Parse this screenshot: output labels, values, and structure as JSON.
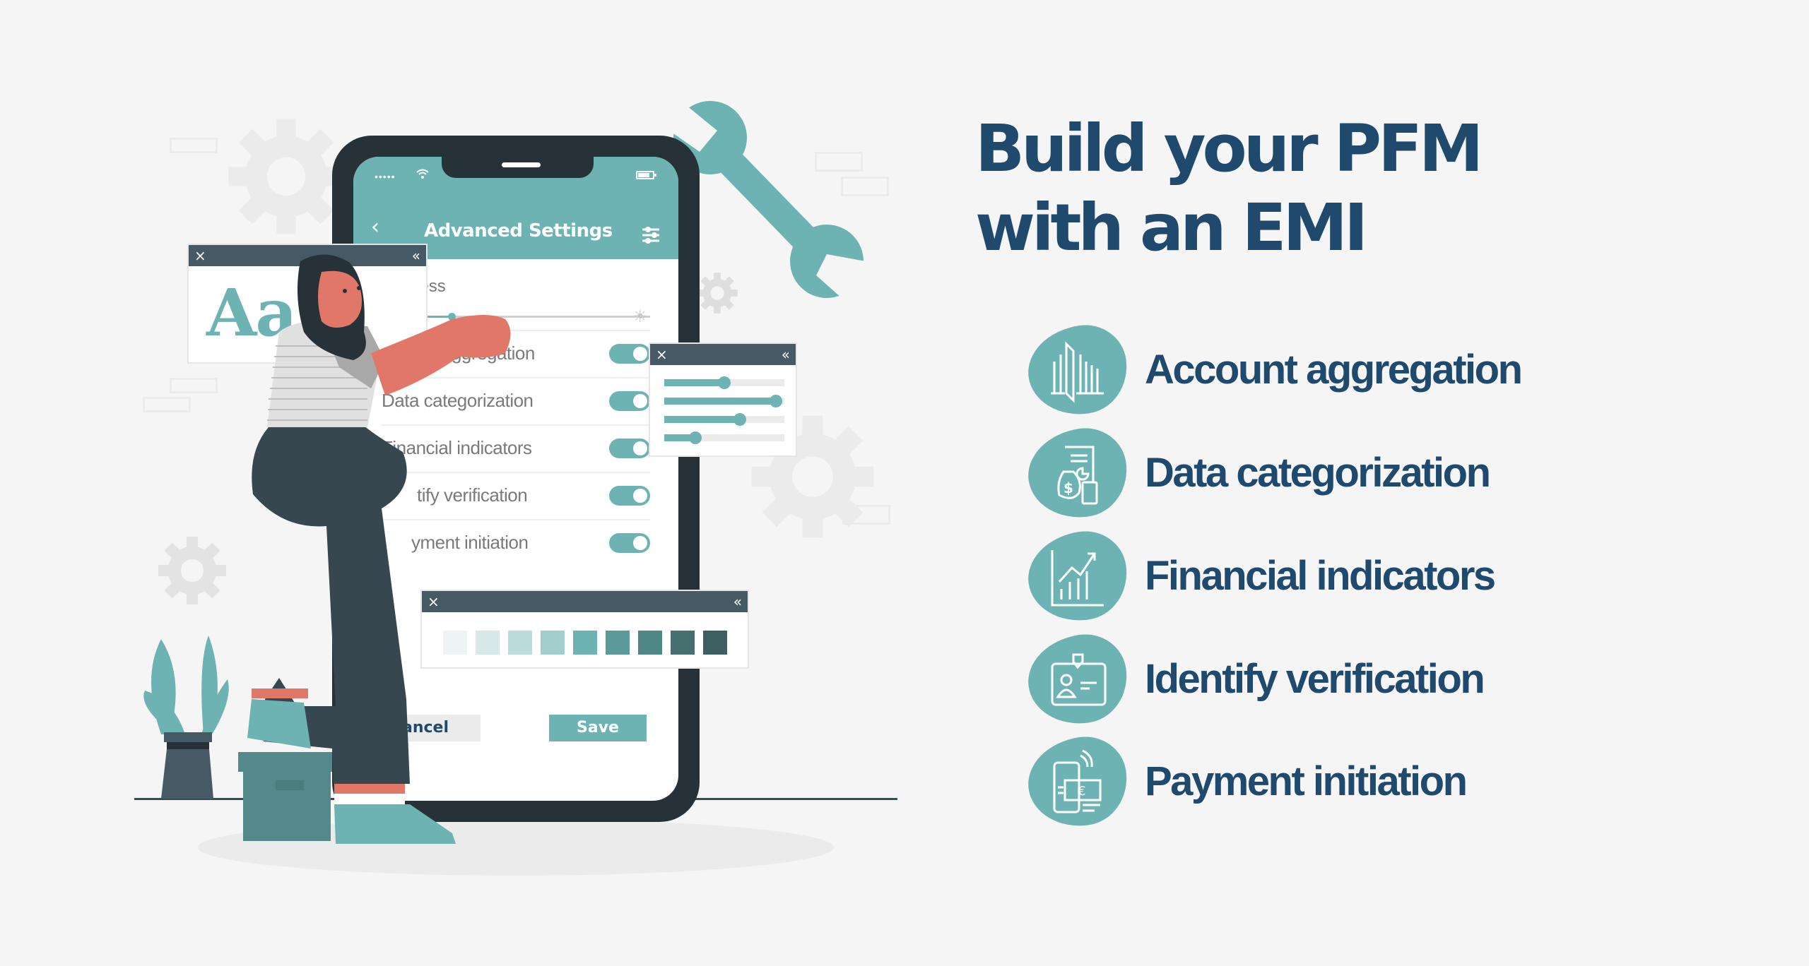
{
  "headline": {
    "line1": "Build your PFM",
    "line2": "with an EMI"
  },
  "colors": {
    "navy": "#1f4a6e",
    "teal": "#6db3b3",
    "dark": "#263238",
    "panel_bar": "#455a64",
    "background": "#f5f5f5"
  },
  "features": [
    {
      "label": "Account aggregation",
      "icon": "account-aggregation-icon"
    },
    {
      "label": "Data categorization",
      "icon": "data-categorization-icon"
    },
    {
      "label": "Financial indicators",
      "icon": "financial-indicators-icon"
    },
    {
      "label": "Identify verification",
      "icon": "identity-card-icon"
    },
    {
      "label": "Payment initiation",
      "icon": "payment-phone-icon"
    }
  ],
  "phone": {
    "status_signal": "•••••",
    "title": "Advanced Settings",
    "back_icon": "‹",
    "brightness_label": "Brightness",
    "brightness_visible_label": "htness",
    "brightness_level": 0.22,
    "settings": [
      {
        "label": "Account aggregation",
        "visible_label": "aggregation",
        "enabled": true
      },
      {
        "label": "Data categorization",
        "visible_label": "Data categorization",
        "enabled": true
      },
      {
        "label": "Financial indicators",
        "visible_label": "Financial indicators",
        "enabled": true
      },
      {
        "label": "Identify verification",
        "visible_label": "tify verification",
        "enabled": true
      },
      {
        "label": "Payment initiation",
        "visible_label": "yment initiation",
        "enabled": true
      }
    ],
    "cancel_label": "Cancel",
    "save_label": "Save"
  },
  "panels": {
    "close_glyph": "×",
    "collapse_glyph": "«",
    "font_sample": "Aa   a",
    "sliders": [
      0.5,
      0.93,
      0.63,
      0.26
    ],
    "swatches": [
      "#eef4f4",
      "#d6e8e8",
      "#bcdcdb",
      "#a1cfcd",
      "#6db3b3",
      "#5a9b9a",
      "#4f8786",
      "#46706f",
      "#3d5f62"
    ]
  }
}
